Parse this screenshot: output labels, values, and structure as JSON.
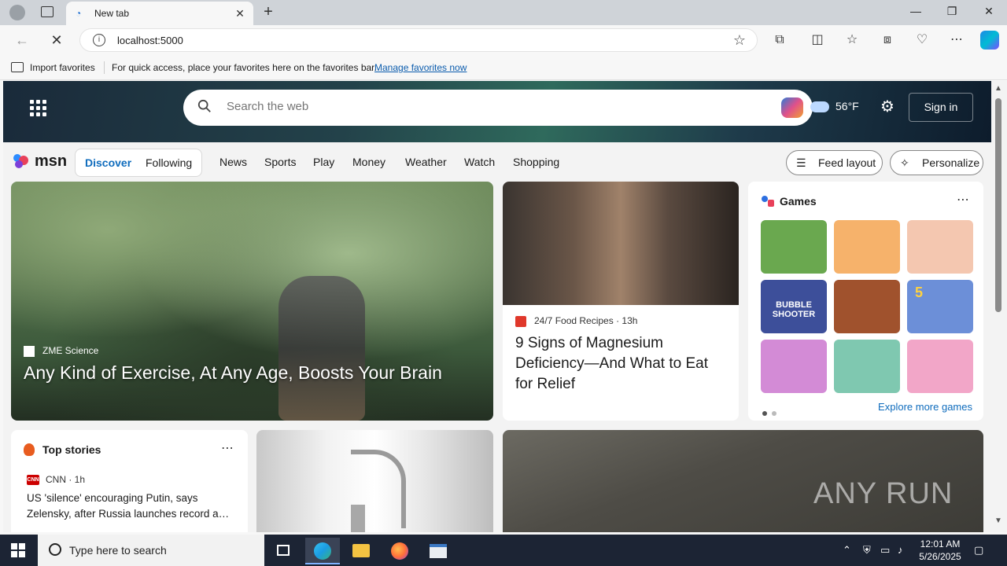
{
  "browser": {
    "tab_title": "New tab",
    "url": "localhost:5000",
    "favorites": {
      "import_label": "Import favorites",
      "hint": "For quick access, place your favorites here on the favorites bar.",
      "manage_link": "Manage favorites now"
    }
  },
  "msn": {
    "search_placeholder": "Search the web",
    "weather_temp": "56°F",
    "sign_in": "Sign in",
    "logo": "msn",
    "tabs": [
      "Discover",
      "Following"
    ],
    "nav": [
      "News",
      "Sports",
      "Play",
      "Money",
      "Weather",
      "Watch",
      "Shopping"
    ],
    "feed_layout": "Feed layout",
    "personalize": "Personalize",
    "hero": {
      "source": "ZME Science",
      "title": "Any Kind of Exercise, At Any Age, Boosts Your Brain"
    },
    "story2": {
      "source": "24/7 Food Recipes",
      "age": "13h",
      "title": "9 Signs of Magnesium Deficiency—And What to Eat for Relief"
    },
    "games": {
      "title": "Games",
      "explore": "Explore more games",
      "tiles": [
        {
          "color": "#6aa84f"
        },
        {
          "color": "#f6b26b"
        },
        {
          "color": "#f4c7b0"
        },
        {
          "color": "#3d4f9a"
        },
        {
          "color": "#a0522d"
        },
        {
          "color": "#6c8fd8"
        },
        {
          "color": "#d38bd6"
        },
        {
          "color": "#7fc8b0"
        },
        {
          "color": "#f2a6c8"
        }
      ],
      "bubble_label": "BUBBLE SHOOTER",
      "number_label": "5"
    },
    "top_stories": {
      "title": "Top stories",
      "source": "CNN",
      "age": "1h",
      "headline": "US 'silence' encouraging Putin, says Zelensky, after Russia launches record a…"
    },
    "watermark": "ANY RUN"
  },
  "taskbar": {
    "search_placeholder": "Type here to search",
    "time": "12:01 AM",
    "date": "5/26/2025"
  }
}
